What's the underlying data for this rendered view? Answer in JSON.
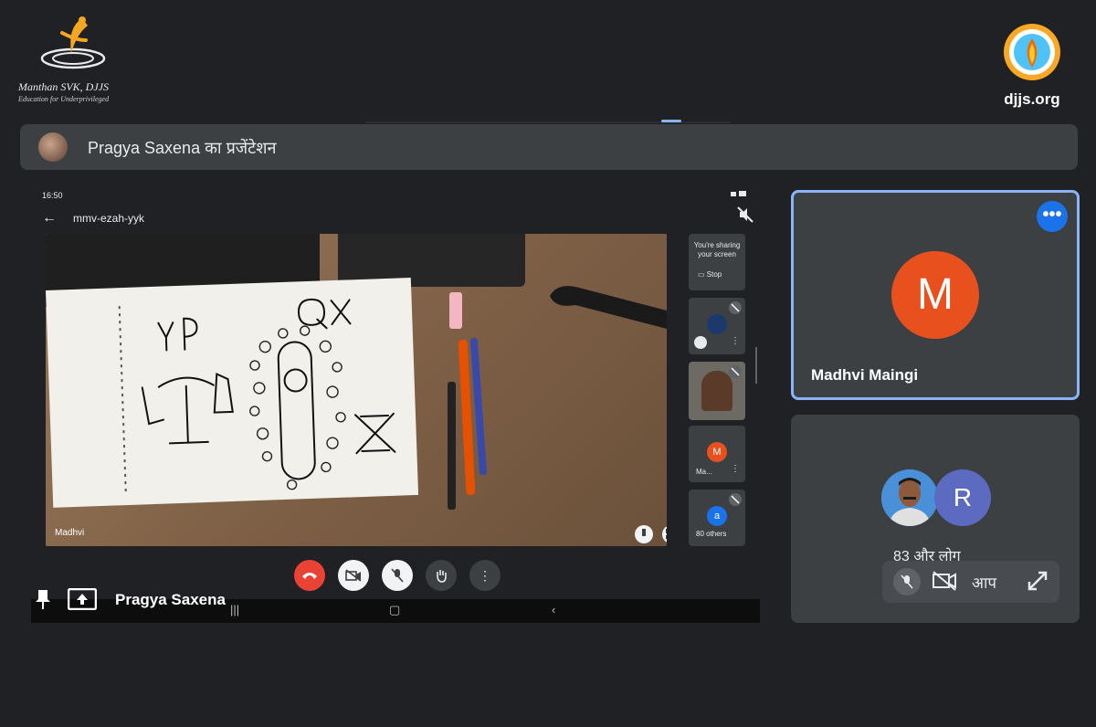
{
  "branding": {
    "left_line1": "Manthan SVK, DJJS",
    "left_line2": "Education for Underprivileged",
    "right_url": "djjs.org"
  },
  "banner": {
    "title": "Pragya Saxena का प्रजेंटेशन"
  },
  "shared_screen": {
    "status_time": "16:50",
    "meeting_code": "mmv-ezah-yyk",
    "video_label": "Madhvi",
    "sharing_notice_line1": "You're sharing",
    "sharing_notice_line2": "your screen",
    "stop_label": "Stop",
    "tile_m_letter": "M",
    "tile_m_name": "Ma...",
    "tile_a_letter": "a",
    "tile_others_label": "80 others",
    "presenter_name": "Pragya Saxena"
  },
  "participants": {
    "main_initial": "M",
    "main_name": "Madhvi Maingi",
    "other_initial": "R",
    "others_count": "83 और लोग",
    "self_label": "आप"
  },
  "colors": {
    "background": "#202124",
    "banner": "#3c4043",
    "active_border": "#8ab4f8",
    "avatar_m": "#e8501e",
    "avatar_r": "#5c6bc0",
    "end_call": "#ea4335",
    "more_button": "#1a73e8"
  },
  "icons": [
    "pin-icon",
    "present-screen-icon",
    "more-options-icon",
    "mic-off-icon",
    "camera-off-icon",
    "expand-icon",
    "end-call-icon",
    "raise-hand-icon",
    "back-arrow-icon"
  ]
}
